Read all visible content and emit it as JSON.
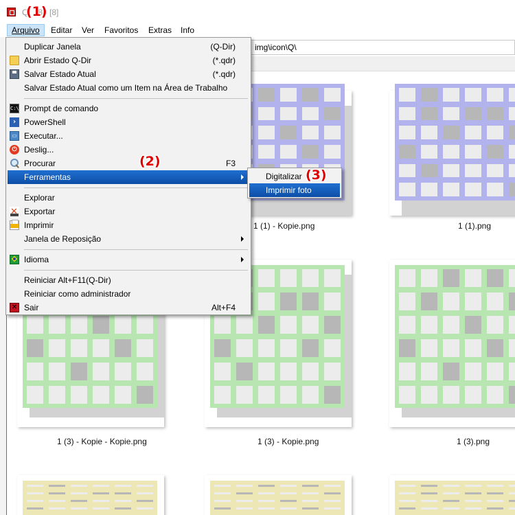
{
  "window": {
    "title": "Q-Dir 11.86 [8]",
    "title_visible_suffix": ".86 [8]"
  },
  "annotations": {
    "marker1": "(1)",
    "marker2": "(2)",
    "marker3": "(3)"
  },
  "menubar": {
    "items": [
      {
        "label": "Arquivo",
        "active": true
      },
      {
        "label": "Editar"
      },
      {
        "label": "Ver"
      },
      {
        "label": "Favoritos"
      },
      {
        "label": "Extras"
      },
      {
        "label": "Info"
      }
    ]
  },
  "address": {
    "path": "img\\icon\\Q\\"
  },
  "file_menu": {
    "items": [
      {
        "label": "Duplicar Janela",
        "shortcut": "(Q-Dir)",
        "icon": "none"
      },
      {
        "label": "Abrir Estado Q-Dir",
        "shortcut": "(*.qdr)",
        "icon": "folder-icon"
      },
      {
        "label": "Salvar Estado Atual",
        "shortcut": "(*.qdr)",
        "icon": "disk-icon"
      },
      {
        "label": "Salvar Estado Atual como um Item na Área de Trabalho",
        "shortcut": "",
        "icon": "none"
      },
      {
        "label": "Prompt de comando",
        "shortcut": "",
        "icon": "cmd-icon"
      },
      {
        "label": "PowerShell",
        "shortcut": "",
        "icon": "powershell-icon"
      },
      {
        "label": "Executar...",
        "shortcut": "",
        "icon": "run-icon"
      },
      {
        "label": "Deslig...",
        "shortcut": "",
        "icon": "power-icon"
      },
      {
        "label": "Procurar",
        "shortcut": "F3",
        "icon": "search-icon"
      },
      {
        "label": "Ferramentas",
        "shortcut": "",
        "icon": "none",
        "submenu": true,
        "selected": true
      },
      {
        "label": "Explorar",
        "shortcut": "",
        "icon": "none"
      },
      {
        "label": "Exportar",
        "shortcut": "",
        "icon": "export-icon"
      },
      {
        "label": "Imprimir",
        "shortcut": "",
        "icon": "print-icon"
      },
      {
        "label": "Janela de Reposição",
        "shortcut": "",
        "icon": "none",
        "submenu": true
      },
      {
        "label": "Idioma",
        "shortcut": "",
        "icon": "flag-icon",
        "submenu": true
      },
      {
        "label": "Reiniciar Alt+F11(Q-Dir)",
        "shortcut": "",
        "icon": "none"
      },
      {
        "label": "Reiniciar como administrador",
        "shortcut": "",
        "icon": "none"
      },
      {
        "label": "Sair",
        "shortcut": "Alt+F4",
        "icon": "exit-icon"
      }
    ]
  },
  "tools_submenu": {
    "items": [
      {
        "label": "Digitalizar"
      },
      {
        "label": "Imprimir foto",
        "selected": true
      }
    ]
  },
  "files": {
    "captions": [
      "1 (1) - Kopie.png",
      "1 (1).png",
      "1 (3) - Kopie - Kopie.png",
      "1 (3) - Kopie.png",
      "1 (3).png"
    ]
  },
  "colors": {
    "menu_highlight": "#0d4ea6",
    "menubar_active": "#cce4f7",
    "marker": "#e00000",
    "thumb_purple": "#b2b2ec",
    "thumb_green": "#b7e6b1",
    "thumb_yellow": "#ece7b5"
  }
}
